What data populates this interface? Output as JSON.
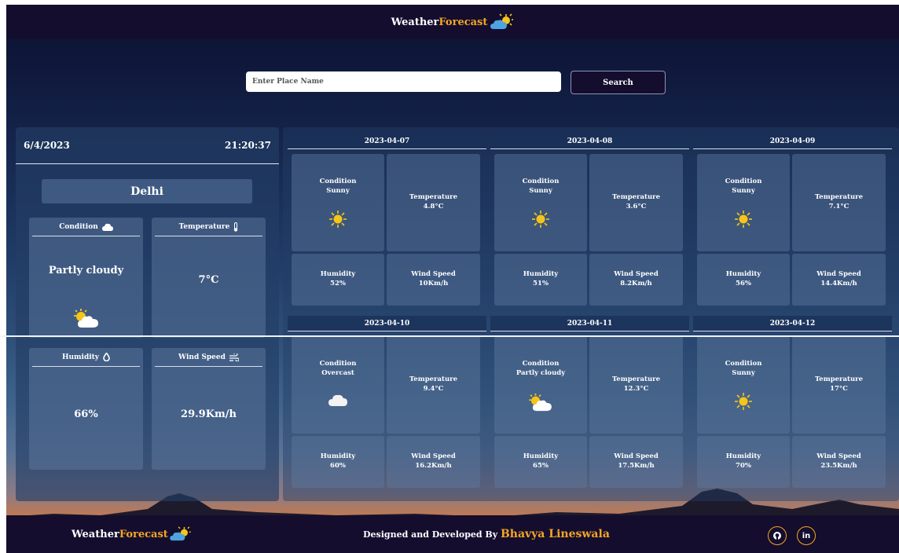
{
  "header": {
    "brand_main": "Weather",
    "brand_accent": "Forecast"
  },
  "search": {
    "placeholder": "Enter Place Name",
    "button_label": "Search"
  },
  "current": {
    "date": "6/4/2023",
    "time": "21:20:37",
    "city": "Delhi",
    "condition_title": "Condition",
    "condition_value": "Partly cloudy",
    "temperature_title": "Temperature",
    "temperature_value": "7°C",
    "humidity_title": "Humidity",
    "humidity_value": "66%",
    "wind_title": "Wind Speed",
    "wind_value": "29.9Km/h"
  },
  "forecast": [
    {
      "date": "2023-04-07",
      "condition_label": "Condition",
      "condition": "Sunny",
      "icon": "sun-icon",
      "temp_label": "Temperature",
      "temp": "4.8°C",
      "humidity_label": "Humidity",
      "humidity": "52%",
      "wind_label": "Wind Speed",
      "wind": "10Km/h"
    },
    {
      "date": "2023-04-08",
      "condition_label": "Condition",
      "condition": "Sunny",
      "icon": "sun-icon",
      "temp_label": "Temperature",
      "temp": "3.6°C",
      "humidity_label": "Humidity",
      "humidity": "51%",
      "wind_label": "Wind Speed",
      "wind": "8.2Km/h"
    },
    {
      "date": "2023-04-09",
      "condition_label": "Condition",
      "condition": "Sunny",
      "icon": "sun-icon",
      "temp_label": "Temperature",
      "temp": "7.1°C",
      "humidity_label": "Humidity",
      "humidity": "56%",
      "wind_label": "Wind Speed",
      "wind": "14.4Km/h"
    },
    {
      "date": "2023-04-10",
      "condition_label": "Condition",
      "condition": "Overcast",
      "icon": "cloud-icon",
      "temp_label": "Temperature",
      "temp": "9.4°C",
      "humidity_label": "Humidity",
      "humidity": "60%",
      "wind_label": "Wind Speed",
      "wind": "16.2Km/h"
    },
    {
      "date": "2023-04-11",
      "condition_label": "Condition",
      "condition": "Partly cloudy",
      "icon": "partly-cloudy-icon",
      "temp_label": "Temperature",
      "temp": "12.3°C",
      "humidity_label": "Humidity",
      "humidity": "65%",
      "wind_label": "Wind Speed",
      "wind": "17.5Km/h"
    },
    {
      "date": "2023-04-12",
      "condition_label": "Condition",
      "condition": "Sunny",
      "icon": "sun-icon",
      "temp_label": "Temperature",
      "temp": "17°C",
      "humidity_label": "Humidity",
      "humidity": "70%",
      "wind_label": "Wind Speed",
      "wind": "23.5Km/h"
    }
  ],
  "footer": {
    "brand_main": "Weather",
    "brand_accent": "Forecast",
    "credit_prefix": "Designed and Developed By",
    "credit_name": "Bhavya Lineswala",
    "github_label": "github-icon",
    "linkedin_text": "in"
  },
  "colors": {
    "accent": "#f5a623",
    "header_bg": "#140d2e"
  }
}
